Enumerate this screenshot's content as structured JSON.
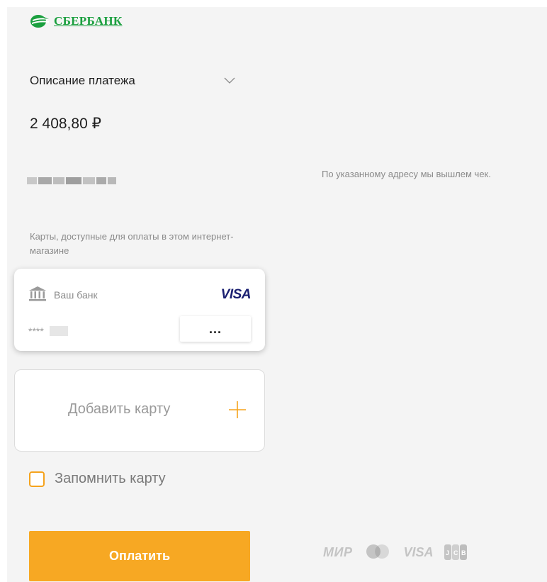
{
  "brand": {
    "name": "СБЕРБАНК",
    "color": "#1a9f3e",
    "icon": "sberbank-logo-icon"
  },
  "payment": {
    "description_label": "Описание платежа",
    "amount": "2 408,80 ₽"
  },
  "receipt_note": "По указанному адресу мы вышлем чек.",
  "cards_note": "Карты, доступные для оплаты в этом интернет-магазине",
  "saved_card": {
    "bank_label": "Ваш банк",
    "network": "VISA",
    "number_mask": "****",
    "more_label": "..."
  },
  "add_card": {
    "label": "Добавить карту",
    "icon": "plus-icon"
  },
  "remember_card": {
    "label": "Запомнить карту",
    "checked": false
  },
  "pay_button": {
    "label": "Оплатить",
    "color": "#f7a823"
  },
  "payment_systems": {
    "mir": "МИР",
    "visa": "VISA"
  },
  "colors": {
    "accent": "#f7a823",
    "muted_text": "#8a8a8a",
    "background": "#f4f4f4"
  }
}
